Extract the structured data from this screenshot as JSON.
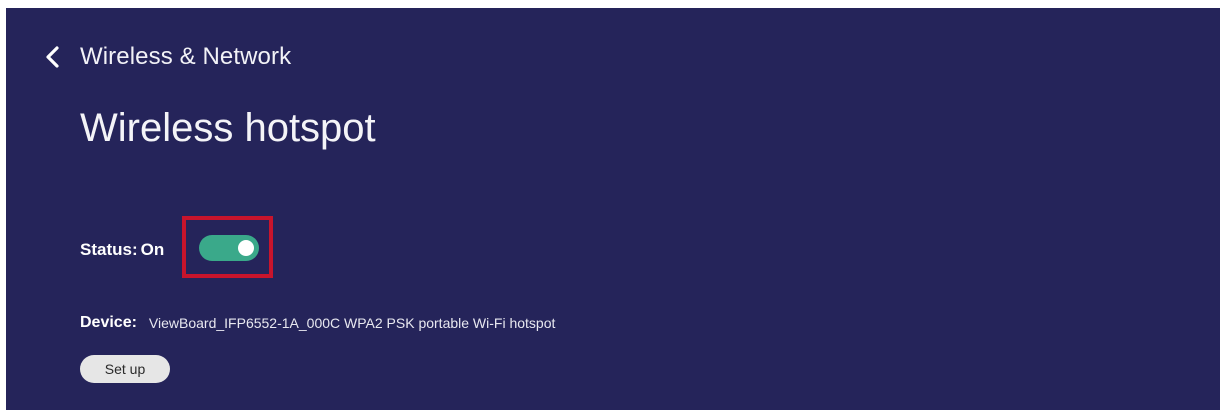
{
  "header": {
    "back_icon": "chevron-left-icon",
    "back_label": "Wireless & Network"
  },
  "page": {
    "title": "Wireless hotspot"
  },
  "status": {
    "label": "Status:",
    "value": "On",
    "toggle_on": true,
    "toggle_color": "#3aa98a",
    "highlight_color": "#c8142c"
  },
  "device": {
    "label": "Device:",
    "value": "ViewBoard_IFP6552-1A_000C WPA2 PSK portable Wi-Fi hotspot"
  },
  "actions": {
    "setup_label": "Set up"
  },
  "theme": {
    "background": "#25245a"
  }
}
